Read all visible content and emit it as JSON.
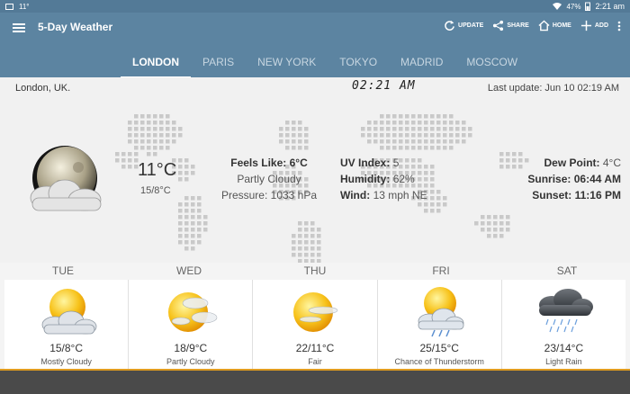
{
  "statusbar": {
    "left_text": "11°",
    "battery": "47%",
    "time": "2:21 am",
    "icons": [
      "gallery-icon",
      "wifi-icon",
      "battery-icon"
    ]
  },
  "appbar": {
    "title": "5-Day Weather",
    "actions": [
      {
        "label": "UPDATE",
        "icon": "refresh-icon"
      },
      {
        "label": "SHARE",
        "icon": "share-icon"
      },
      {
        "label": "HOME",
        "icon": "home-icon"
      },
      {
        "label": "ADD",
        "icon": "plus-icon"
      }
    ],
    "overflow_icon": "more-vert-icon",
    "menu_icon": "hamburger-icon"
  },
  "tabs": [
    {
      "label": "LONDON",
      "active": true
    },
    {
      "label": "PARIS",
      "active": false
    },
    {
      "label": "NEW YORK",
      "active": false
    },
    {
      "label": "TOKYO",
      "active": false
    },
    {
      "label": "MADRID",
      "active": false
    },
    {
      "label": "MOSCOW",
      "active": false
    }
  ],
  "current": {
    "location": "London, UK.",
    "clock": "02:21 AM",
    "last_update": "Last update: Jun 10  02:19 AM",
    "temperature": "11°C",
    "hilo": "15/8°C",
    "feels_like_label": "Feels Like:",
    "feels_like_value": "6°C",
    "condition": "Partly Cloudy",
    "pressure_label": "Pressure:",
    "pressure_value": "1033 hPa",
    "uv_label": "UV Index:",
    "uv_value": "5",
    "humidity_label": "Humidity:",
    "humidity_value": "62%",
    "wind_label": "Wind:",
    "wind_value": "13 mph NE",
    "dew_label": "Dew Point:",
    "dew_value": "4°C",
    "sunrise_label": "Sunrise:",
    "sunrise_value": "06:44 AM",
    "sunset_label": "Sunset:",
    "sunset_value": "11:16 PM",
    "icon": "moon-cloud-icon"
  },
  "forecast": [
    {
      "day": "TUE",
      "range": "15/8°C",
      "condition": "Mostly Cloudy",
      "icon": "sun-cloud-icon"
    },
    {
      "day": "WED",
      "range": "18/9°C",
      "condition": "Partly Cloudy",
      "icon": "sun-partly-cloudy-icon"
    },
    {
      "day": "THU",
      "range": "22/11°C",
      "condition": "Fair",
      "icon": "sun-fair-icon"
    },
    {
      "day": "FRI",
      "range": "25/15°C",
      "condition": "Chance of Thunderstorm",
      "icon": "sun-storm-icon"
    },
    {
      "day": "SAT",
      "range": "23/14°C",
      "condition": "Light Rain",
      "icon": "rain-cloud-icon"
    }
  ]
}
